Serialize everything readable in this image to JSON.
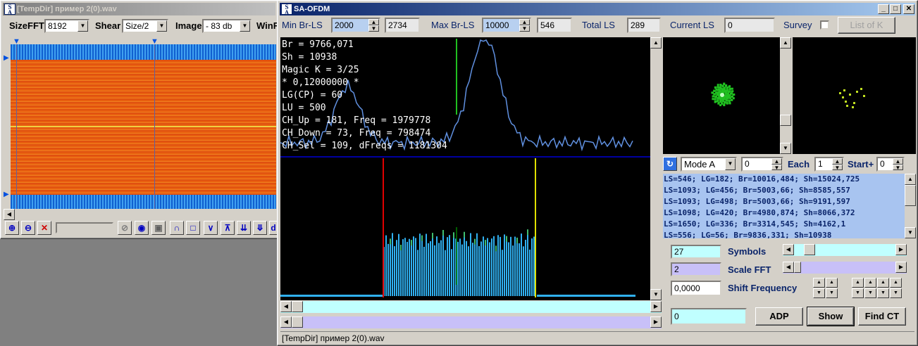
{
  "left_window": {
    "title": "[TempDir] пример 2(0).wav",
    "sizefft_label": "SizeFFT",
    "sizefft_value": "8192",
    "shear_label": "Shear",
    "shear_value": "Size/2",
    "image_label": "Image",
    "image_value": "- 83 db",
    "winf_label": "WinF",
    "toolbar_icons": [
      "zoom-in-icon",
      "zoom-out-icon",
      "close-red-icon",
      "circle-slash-icon",
      "speaker-icon",
      "frame-icon",
      "arch-icon",
      "square-icon",
      "valley-icon",
      "anchor-icon",
      "arrows-down-icon",
      "triple-arrows-icon",
      "d-icon"
    ]
  },
  "main_window": {
    "title": "SA-OFDM",
    "min_brls_label": "Min Br-LS",
    "min_brls_value": "2000",
    "min_brls_value2": "2734",
    "max_brls_label": "Max Br-LS",
    "max_brls_value": "10000",
    "max_brls_value2": "546",
    "total_ls_label": "Total LS",
    "total_ls_value": "289",
    "current_ls_label": "Current LS",
    "current_ls_value": "0",
    "survey_label": "Survey",
    "listk_label": "List of K",
    "info_lines": [
      "Br = 9766,071",
      "Sh = 10938",
      "Magic K = 3/25",
      "* 0,12000000 *",
      "LG(CP) = 60",
      "LU = 500",
      "CH_Up = 181, Freq = 1979778",
      "CH_Down = 73, Freq = 798474",
      "CH_Sel = 109, dFreqs = 1181304"
    ],
    "mode_value": "Mode A",
    "mode_spin_value": "0",
    "each_label": "Each",
    "each_value": "1",
    "start_label": "Start+",
    "start_value": "0",
    "ls_list": [
      "LS=546; LG=182; Br=10016,484; Sh=15024,725",
      "LS=1093; LG=456; Br=5003,66; Sh=8585,557",
      "LS=1093; LG=498; Br=5003,66; Sh=9191,597",
      "LS=1098; LG=420; Br=4980,874; Sh=8066,372",
      "LS=1650; LG=336; Br=3314,545; Sh=4162,1",
      "LS=556; LG=56; Br=9836,331; Sh=10938"
    ],
    "symbols_value": "27",
    "symbols_label": "Symbols",
    "scale_value": "2",
    "scale_label": "Scale FFT",
    "shift_value": "0,0000",
    "shift_label": "Shift Frequency",
    "bottom_value": "0",
    "adp_label": "ADP",
    "show_label": "Show",
    "findct_label": "Find CT",
    "status_text": "[TempDir] пример 2(0).wav"
  },
  "colors": {
    "spectrum_line": "#6090e0",
    "bar_cyan": "#30b0f0",
    "marker_red": "#e00000",
    "marker_yellow": "#e0e000",
    "marker_green": "#20c020",
    "divider_blue": "#0000a0",
    "list_bg": "#a8c4f0"
  }
}
